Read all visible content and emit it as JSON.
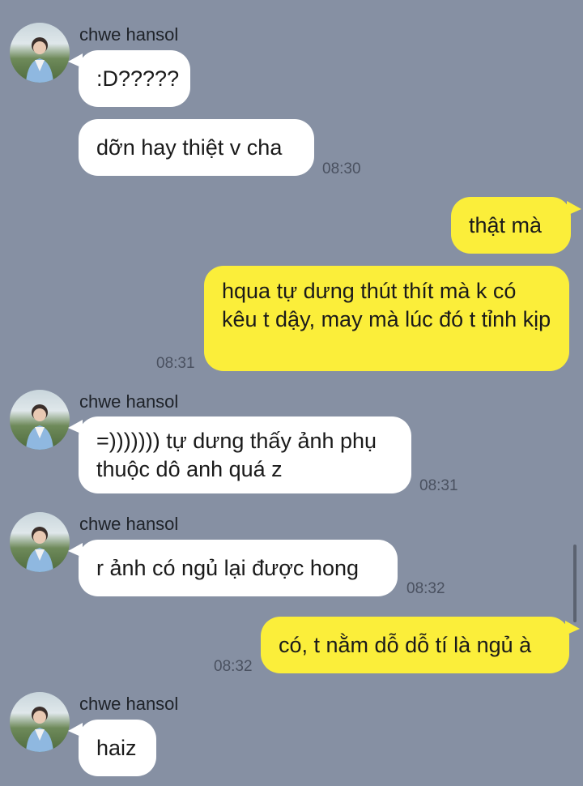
{
  "contact": {
    "name": "chwe hansol"
  },
  "colors": {
    "background": "#8690a3",
    "incoming_bubble": "#ffffff",
    "outgoing_bubble": "#fbee3a"
  },
  "messages": [
    {
      "direction": "in",
      "sender": "chwe hansol",
      "text": ":D?????",
      "time": ""
    },
    {
      "direction": "in",
      "sender": "",
      "text": "dỡn hay thiệt v cha",
      "time": "08:30"
    },
    {
      "direction": "out",
      "text": "thật mà",
      "time": ""
    },
    {
      "direction": "out",
      "text": "hqua tự dưng thút thít mà k có kêu t dậy, may mà lúc đó t tỉnh kịp",
      "time": "08:31"
    },
    {
      "direction": "in",
      "sender": "chwe hansol",
      "text": "=))))))) tự dưng thấy ảnh phụ thuộc dô anh quá z",
      "time": "08:31"
    },
    {
      "direction": "in",
      "sender": "chwe hansol",
      "text": "r ảnh có ngủ lại được hong",
      "time": "08:32"
    },
    {
      "direction": "out",
      "text": "có, t nằm dỗ dỗ tí là ngủ à",
      "time": "08:32"
    },
    {
      "direction": "in",
      "sender": "chwe hansol",
      "text": "haiz",
      "time": ""
    }
  ]
}
